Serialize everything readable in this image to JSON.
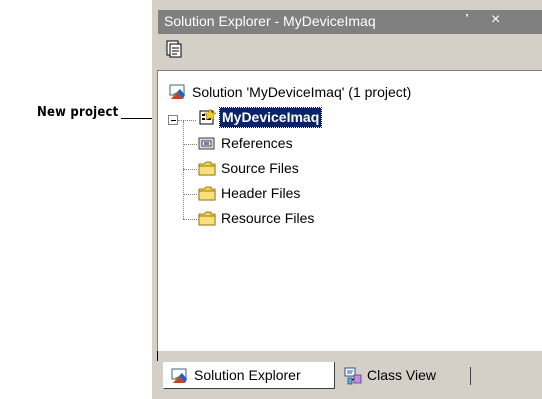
{
  "callout": {
    "label": "New project"
  },
  "panel": {
    "title": "Solution Explorer - MyDeviceImaq",
    "pin_glyph": "҆",
    "close_glyph": "×"
  },
  "tree": {
    "solution": "Solution 'MyDeviceImaq' (1 project)",
    "project": "MyDeviceImaq",
    "children": [
      "References",
      "Source Files",
      "Header Files",
      "Resource Files"
    ]
  },
  "tabs": [
    {
      "label": "Solution Explorer",
      "active": true
    },
    {
      "label": "Class View",
      "active": false
    }
  ],
  "icons": {
    "toolbar": "properties-icon",
    "solution": "solution-icon",
    "project": "project-icon",
    "references": "references-icon",
    "folder": "folder-icon",
    "class_view": "class-view-icon"
  },
  "colors": {
    "selection": "#0a246a",
    "titlebar": "#808080",
    "panel": "#d4d0c8",
    "folder": "#f7d54a"
  }
}
